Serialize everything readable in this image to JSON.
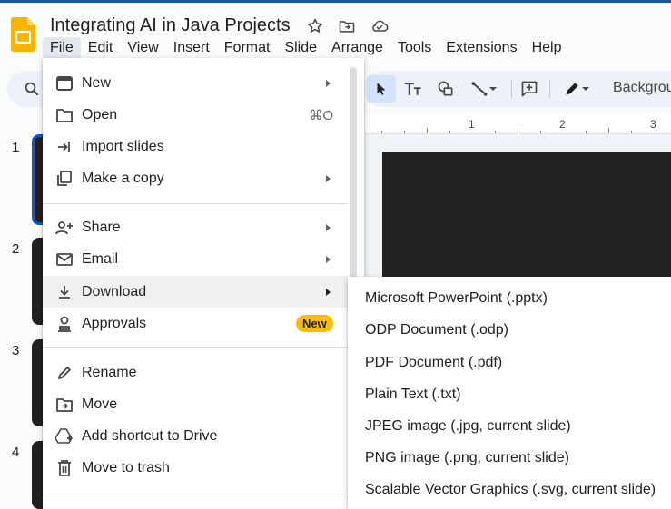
{
  "document": {
    "title": "Integrating AI in Java Projects",
    "star_icon": "star-icon",
    "move_icon": "folder-move-icon",
    "cloud_icon": "cloud-saved-icon"
  },
  "menubar": {
    "items": [
      "File",
      "Edit",
      "View",
      "Insert",
      "Format",
      "Slide",
      "Arrange",
      "Tools",
      "Extensions",
      "Help"
    ],
    "active": "File"
  },
  "toolbar": {
    "background_label": "Backgrou"
  },
  "ruler": {
    "labels": [
      "1",
      "2",
      "3"
    ]
  },
  "slides": {
    "numbers": [
      "1",
      "2",
      "3",
      "4"
    ]
  },
  "file_menu": {
    "items": [
      {
        "label": "New",
        "icon": "presentation-icon",
        "submenu": true
      },
      {
        "label": "Open",
        "icon": "folder-open-icon",
        "shortcut": "⌘O"
      },
      {
        "label": "Import slides",
        "icon": "import-icon"
      },
      {
        "label": "Make a copy",
        "icon": "copy-icon",
        "submenu": true
      },
      {
        "label": "Share",
        "icon": "person-add-icon",
        "submenu": true
      },
      {
        "label": "Email",
        "icon": "email-icon",
        "submenu": true
      },
      {
        "label": "Download",
        "icon": "download-icon",
        "submenu": true
      },
      {
        "label": "Approvals",
        "icon": "approvals-icon",
        "badge": "New"
      },
      {
        "label": "Rename",
        "icon": "pencil-icon"
      },
      {
        "label": "Move",
        "icon": "folder-move-icon"
      },
      {
        "label": "Add shortcut to Drive",
        "icon": "drive-shortcut-icon"
      },
      {
        "label": "Move to trash",
        "icon": "trash-icon"
      }
    ]
  },
  "download_submenu": {
    "items": [
      "Microsoft PowerPoint (.pptx)",
      "ODP Document (.odp)",
      "PDF Document (.pdf)",
      "Plain Text (.txt)",
      "JPEG image (.jpg, current slide)",
      "PNG image (.png, current slide)",
      "Scalable Vector Graphics (.svg, current slide)"
    ]
  },
  "colors": {
    "accent": "#0b57d0",
    "badge": "#fbbc04",
    "slides_logo": "#f4b400",
    "menu_highlight": "#f0f0f0"
  }
}
